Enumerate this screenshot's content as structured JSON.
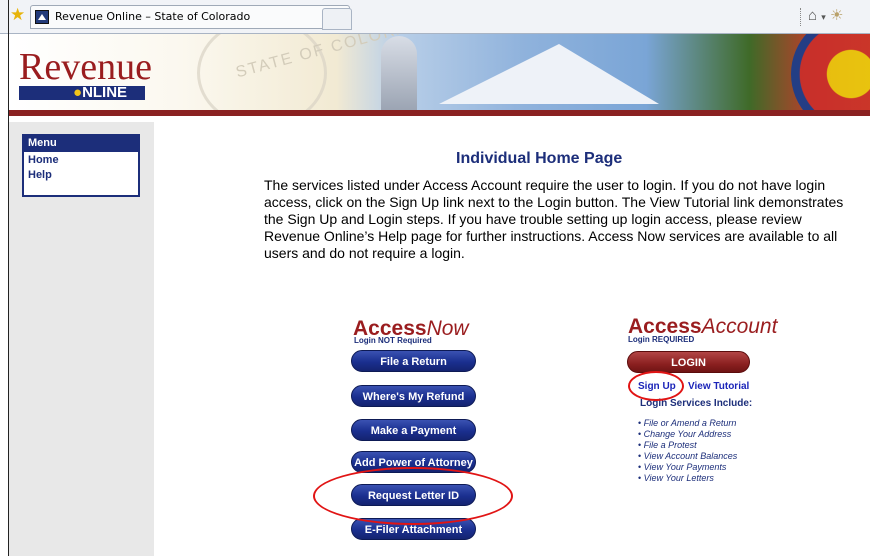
{
  "browser": {
    "tab_title": "Revenue Online – State of Colorado",
    "icons": [
      "favorites-star-icon",
      "site-favicon",
      "home-icon",
      "dropdown-arrow-icon",
      "feeds-icon"
    ]
  },
  "banner": {
    "logo_word": "Revenue",
    "logo_online_o": "●",
    "logo_online_rest": "NLINE",
    "seal_text": "STATE OF COLORADO"
  },
  "menu": {
    "heading": "Menu",
    "items": [
      "Home",
      "Help"
    ]
  },
  "main": {
    "title": "Individual Home Page",
    "intro": "The services listed under Access Account require the user to login. If you do not have login access, click on the Sign Up link next to the Login button. The View Tutorial link demonstrates the Sign Up and Login steps. If you have trouble setting up login access, please review Revenue Online’s Help page for further instructions. Access Now services are available to all users and do not require a login."
  },
  "access_now": {
    "brand_bold": "Access",
    "brand_italic": "Now",
    "subtitle": "Login NOT Required",
    "buttons": [
      "File a Return",
      "Where's My Refund",
      "Make a Payment",
      "Add Power of Attorney",
      "Request Letter ID",
      "E-Filer Attachment"
    ]
  },
  "access_account": {
    "brand_bold": "Access",
    "brand_italic": "Account",
    "subtitle": "Login REQUIRED",
    "login_label": "LOGIN",
    "signup_label": "Sign Up",
    "tutorial_label": "View Tutorial",
    "services_heading": "Login Services Include:",
    "services": [
      "File or Amend a Return",
      "Change Your Address",
      "File a Protest",
      "View Account Balances",
      "View Your Payments",
      "View Your Letters"
    ]
  },
  "colors": {
    "navy": "#1c2e7a",
    "maroon": "#9a1d1f",
    "annotation_red": "#e11414"
  }
}
